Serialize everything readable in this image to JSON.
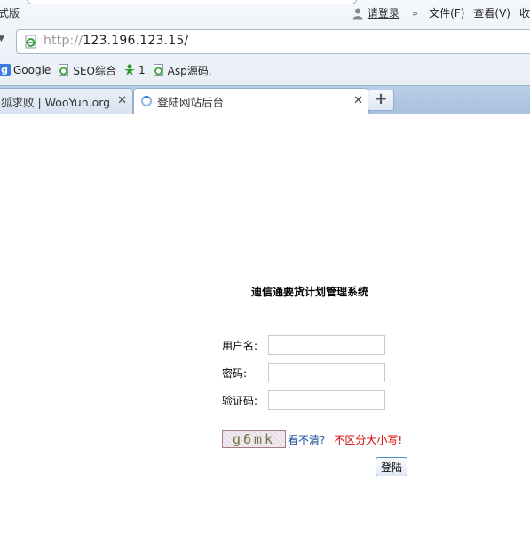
{
  "browser": {
    "mode_label": "式版",
    "login_link": "请登录",
    "menu": [
      "文件(F)",
      "查看(V)",
      "收"
    ],
    "url_protocol": "http://",
    "url_host": "123.196.123.15/",
    "favorites": [
      {
        "label": "Google",
        "icon": "google-icon"
      },
      {
        "label": "SEO综合",
        "icon": "ie-page-icon"
      },
      {
        "label": "1",
        "icon": "green-figure-icon"
      },
      {
        "label": "Asp源码,",
        "icon": "ie-page-icon"
      }
    ],
    "tabs": [
      {
        "label": "狐求败 | WooYun.org",
        "active": false
      },
      {
        "label": "登陆网站后台",
        "active": true
      }
    ],
    "new_tab_label": "+"
  },
  "page": {
    "system_title": "迪信通要货计划管理系统",
    "fields": [
      {
        "label": "用户名:",
        "value": ""
      },
      {
        "label": "密码:",
        "value": ""
      },
      {
        "label": "验证码:",
        "value": ""
      }
    ],
    "captcha_text": "g6mk",
    "refresh_link": "看不清?",
    "case_note": "不区分大小写!",
    "submit_label": "登陆"
  },
  "colors": {
    "link": "#1a4f9c",
    "warning": "#d40000",
    "tabstrip": "#a7c0de"
  }
}
